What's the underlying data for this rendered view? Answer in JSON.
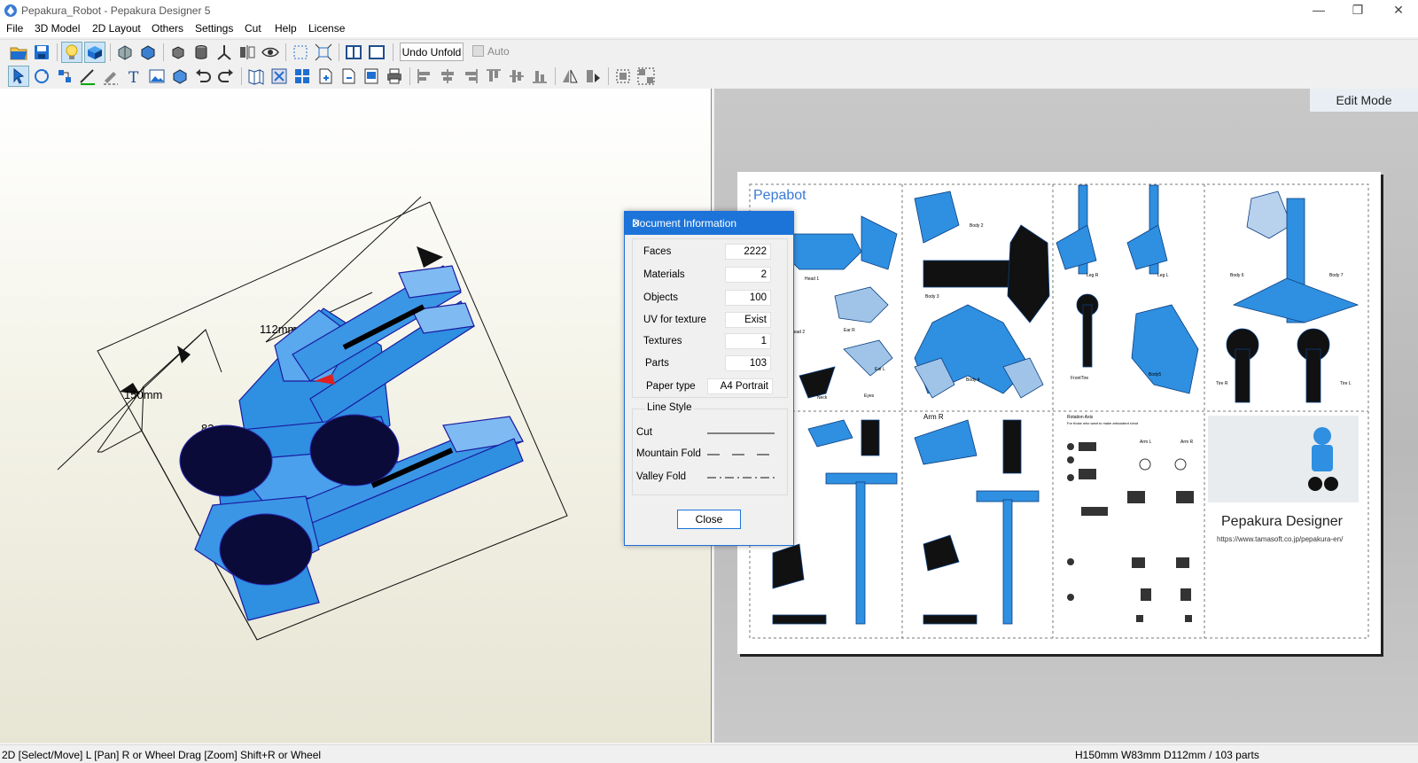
{
  "window": {
    "title": "Pepakura_Robot - Pepakura Designer 5",
    "minimize_glyph": "—",
    "maximize_glyph": "❐",
    "close_glyph": "✕"
  },
  "menu": [
    "File",
    "3D Model",
    "2D Layout",
    "Others",
    "Settings",
    "Cut",
    "Help",
    "License"
  ],
  "toolbar": {
    "undo_unfold_label": "Undo Unfold",
    "auto_label": "Auto"
  },
  "view3d": {
    "dimensions": [
      "112mm",
      "150mm",
      "83mm"
    ]
  },
  "view2d": {
    "mode_label": "Edit Mode",
    "paper_title": "Pepabot",
    "brand_name": "Pepakura Designer",
    "brand_url": "https://www.tamasoft.co.jp/pepakura-en/",
    "part_labels": {
      "head1": "Head 1",
      "head2": "Head 2",
      "earR": "Ear R",
      "earL": "Ear L",
      "neck": "Neck",
      "eyes": "Eyes",
      "body2": "Body 2",
      "body3": "Body 3",
      "body4": "Body 4",
      "legR": "Leg R",
      "legL": "Leg L",
      "frontTire": "FrontTire",
      "body5": "Body5",
      "body6": "Body 6",
      "body7": "Body 7",
      "tireR": "Tire R",
      "tireL": "Tire L",
      "armR": "Arm R",
      "armL": "Arm L",
      "armR2": "Arm R",
      "rotationAxis": "Rotation Axis",
      "rotationNote": "For those who want to make articulated robot"
    }
  },
  "dialog": {
    "title": "Document Information",
    "close_x": "✕",
    "rows": [
      {
        "label": "Faces",
        "value": "2222"
      },
      {
        "label": "Materials",
        "value": "2"
      },
      {
        "label": "Objects",
        "value": "100"
      },
      {
        "label": "UV for texture",
        "value": "Exist"
      },
      {
        "label": "Textures",
        "value": "1"
      },
      {
        "label": "Parts",
        "value": "103"
      },
      {
        "label": "Paper type",
        "value": "A4 Portrait"
      }
    ],
    "line_style_title": "Line Style",
    "line_styles": [
      "Cut",
      "Mountain Fold",
      "Valley Fold"
    ],
    "close_button": "Close"
  },
  "status": {
    "left": "2D [Select/Move] L [Pan] R or Wheel Drag [Zoom] Shift+R or Wheel",
    "right": "H150mm W83mm D112mm / 103 parts"
  },
  "icons": {
    "toolbar1": [
      "open-icon",
      "save-icon",
      "light-bulb-icon",
      "texture-icon",
      "rotate-view-icon",
      "model-view-icon",
      "cube-icon",
      "cylinder-icon",
      "axis-icon",
      "mirror-icon",
      "eye-icon",
      "select-area-icon",
      "fit-icon",
      "split-view-icon",
      "single-view-icon"
    ],
    "toolbar2": [
      "select-move-icon",
      "rotate-part-icon",
      "join-icon",
      "draw-line-icon",
      "edit-fold-icon",
      "text-icon",
      "image-icon",
      "box-icon",
      "undo-icon",
      "redo-icon",
      "unfold-icon",
      "arrange-icon",
      "tile-icon",
      "page-add-icon",
      "page-remove-icon",
      "print-preview-icon",
      "print-icon",
      "align-left-icon",
      "align-center-icon",
      "align-right-icon",
      "align-top-icon",
      "align-middle-icon",
      "align-bottom-icon",
      "flip-h-icon",
      "flip-v-icon",
      "group-icon",
      "ungroup-icon"
    ]
  },
  "colors": {
    "accent": "#1c74d9",
    "part_blue": "#2f8fe0",
    "mode_bg": "#e8eef4"
  }
}
